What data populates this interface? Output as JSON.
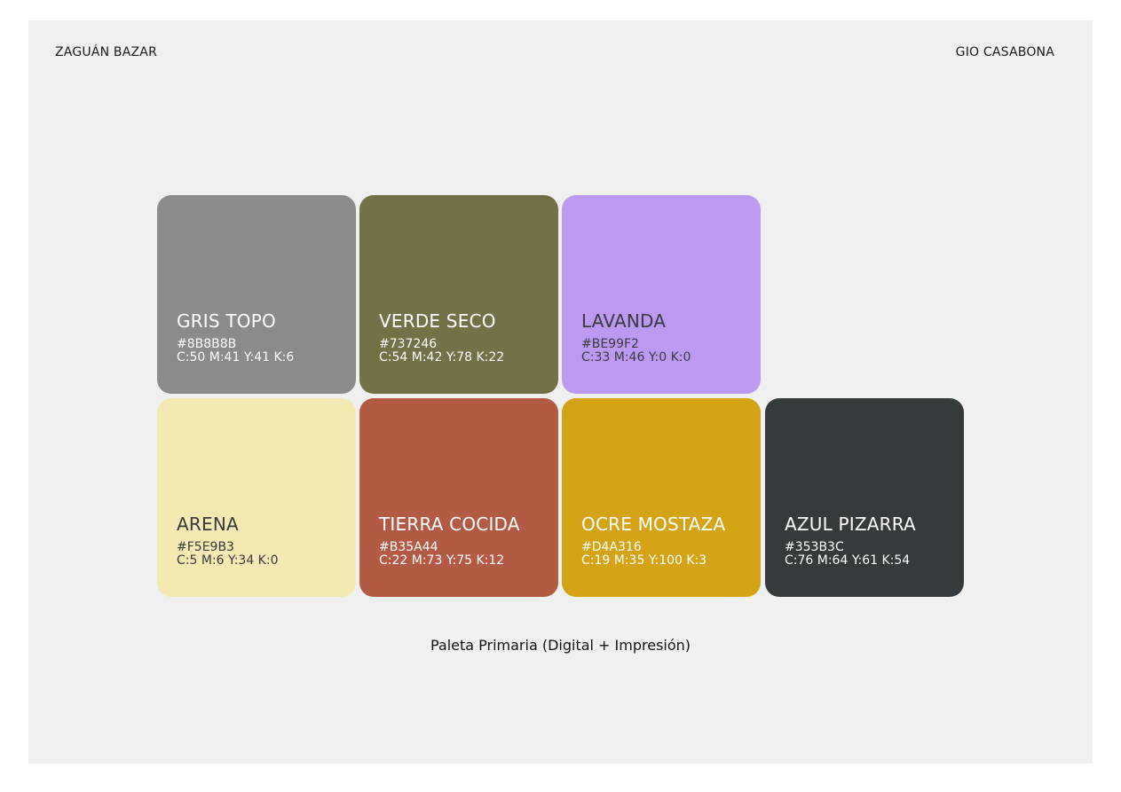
{
  "header": {
    "brand": "ZAGUÁN BAZAR",
    "author": "GIO CASABONA"
  },
  "swatches": [
    {
      "name": "GRIS TOPO",
      "hex": "#8B8B8B",
      "cmyk": "C:50 M:41 Y:41 K:6",
      "color": "#8B8B8B"
    },
    {
      "name": "VERDE SECO",
      "hex": "#737246",
      "cmyk": "C:54 M:42 Y:78 K:22",
      "color": "#737246"
    },
    {
      "name": "LAVANDA",
      "hex": "#BE99F2",
      "cmyk": "C:33 M:46 Y:0 K:0",
      "color": "#BE99F2"
    },
    {
      "name": "ARENA",
      "hex": "#F5E9B3",
      "cmyk": "C:5 M:6 Y:34 K:0",
      "color": "#F5E9B3"
    },
    {
      "name": "TIERRA COCIDA",
      "hex": "#B35A44",
      "cmyk": "C:22 M:73 Y:75 K:12",
      "color": "#B35A44"
    },
    {
      "name": "OCRE MOSTAZA",
      "hex": "#D4A316",
      "cmyk": "C:19 M:35 Y:100 K:3",
      "color": "#D4A316"
    },
    {
      "name": "AZUL PIZARRA",
      "hex": "#353B3C",
      "cmyk": "C:76 M:64 Y:61 K:54",
      "color": "#353B3C"
    }
  ],
  "caption": "Paleta Primaria (Digital + Impresión)"
}
